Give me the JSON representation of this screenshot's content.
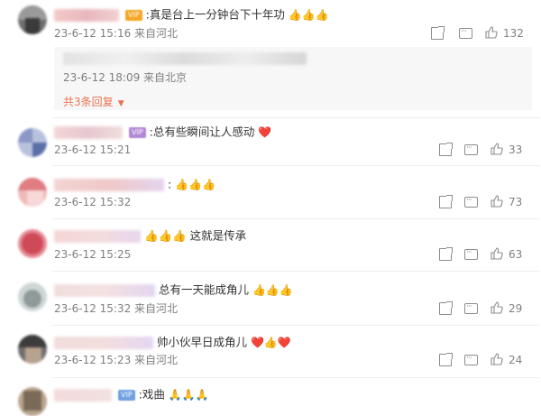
{
  "colors": {
    "accent": "#eb7350",
    "meta": "#808080",
    "heart": "#e02f2f"
  },
  "comments": [
    {
      "text": ":真是台上一分钟台下十年功",
      "emoji": "👍👍👍",
      "meta": "23-6-12 15:16 来自河北",
      "likes": "132",
      "badge": "VIP"
    },
    {
      "text": ":总有些瞬间让人感动",
      "emoji": "❤️",
      "meta": "23-6-12 15:21",
      "likes": "33",
      "badge": "VIP"
    },
    {
      "text": ":",
      "emoji": "👍👍👍",
      "meta": "23-6-12 15:32",
      "likes": "73"
    },
    {
      "text": "这就是传承",
      "emoji": "👍👍👍",
      "meta": "23-6-12 15:25",
      "likes": "63"
    },
    {
      "text": "总有一天能成角儿",
      "emoji": "👍👍👍",
      "meta": "23-6-12 15:32 来自河北",
      "likes": "29"
    },
    {
      "text": "帅小伙早日成角儿",
      "emoji": "❤️👍❤️",
      "meta": "23-6-12 15:23 来自河北",
      "likes": "24"
    },
    {
      "text": ":戏曲",
      "emoji": "🙏🙏🙏",
      "badge": "VIP"
    }
  ],
  "reply": {
    "meta": "23-6-12 18:09 来自北京",
    "more_label": "共3条回复"
  },
  "icons": {
    "share": "share-icon",
    "comment": "comment-icon",
    "like": "like-icon",
    "dropdown": "triangle-down-icon"
  }
}
